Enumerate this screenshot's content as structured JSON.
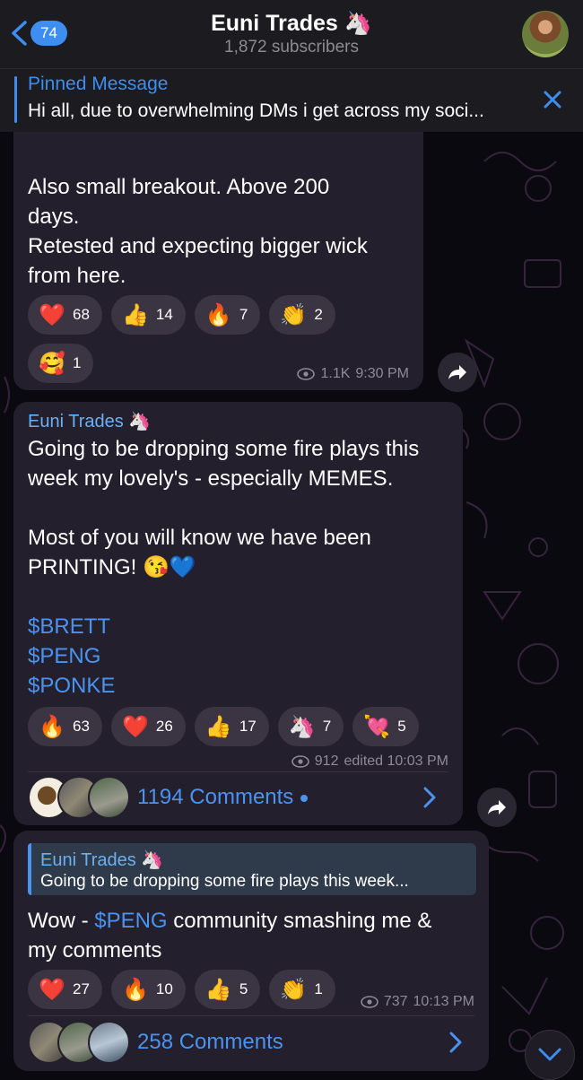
{
  "header": {
    "back_count": "74",
    "title": "Euni Trades 🦄",
    "subscribers": "1,872 subscribers"
  },
  "pinned": {
    "title": "Pinned Message",
    "text": "Hi all, due to overwhelming DMs i get across my soci..."
  },
  "messages": [
    {
      "text_lines": [
        "Also small breakout. Above 200",
        "days.",
        "Retested and expecting bigger wick",
        "from here."
      ],
      "reactions": [
        {
          "emoji": "❤️",
          "count": "68"
        },
        {
          "emoji": "👍",
          "count": "14"
        },
        {
          "emoji": "🔥",
          "count": "7"
        },
        {
          "emoji": "👏",
          "count": "2"
        },
        {
          "emoji": "🥰",
          "count": "1"
        }
      ],
      "views": "1.1K",
      "time": "9:30 PM"
    },
    {
      "sender": "Euni Trades 🦄",
      "text_lines": [
        "Going to be dropping some fire plays this",
        "week my lovely's - especially MEMES.",
        "",
        "Most of you will know we have been",
        "PRINTING! 😘💙"
      ],
      "tickers": [
        "$BRETT",
        "$PENG",
        "$PONKE"
      ],
      "reactions": [
        {
          "emoji": "🔥",
          "count": "63"
        },
        {
          "emoji": "❤️",
          "count": "26"
        },
        {
          "emoji": "👍",
          "count": "17"
        },
        {
          "emoji": "🦄",
          "count": "7"
        },
        {
          "emoji": "💘",
          "count": "5"
        }
      ],
      "views": "912",
      "time": "edited 10:03 PM",
      "comments": "1194 Comments"
    },
    {
      "reply": {
        "name": "Euni Trades 🦄",
        "text": "Going to be dropping some fire plays this week..."
      },
      "text_prefix": "Wow - ",
      "text_ticker": "$PENG",
      "text_suffix": " community smashing me &",
      "text_line2": "my comments",
      "reactions": [
        {
          "emoji": "❤️",
          "count": "27"
        },
        {
          "emoji": "🔥",
          "count": "10"
        },
        {
          "emoji": "👍",
          "count": "5"
        },
        {
          "emoji": "👏",
          "count": "1"
        }
      ],
      "views": "737",
      "time": "10:13 PM",
      "comments": "258 Comments"
    }
  ],
  "colors": {
    "accent": "#3d8ef0",
    "bubble": "#231f2c",
    "background": "#0b0910"
  },
  "icons": [
    "back-chevron-icon",
    "close-icon",
    "eye-icon",
    "forward-icon",
    "chevron-right-icon",
    "chevron-down-icon"
  ]
}
